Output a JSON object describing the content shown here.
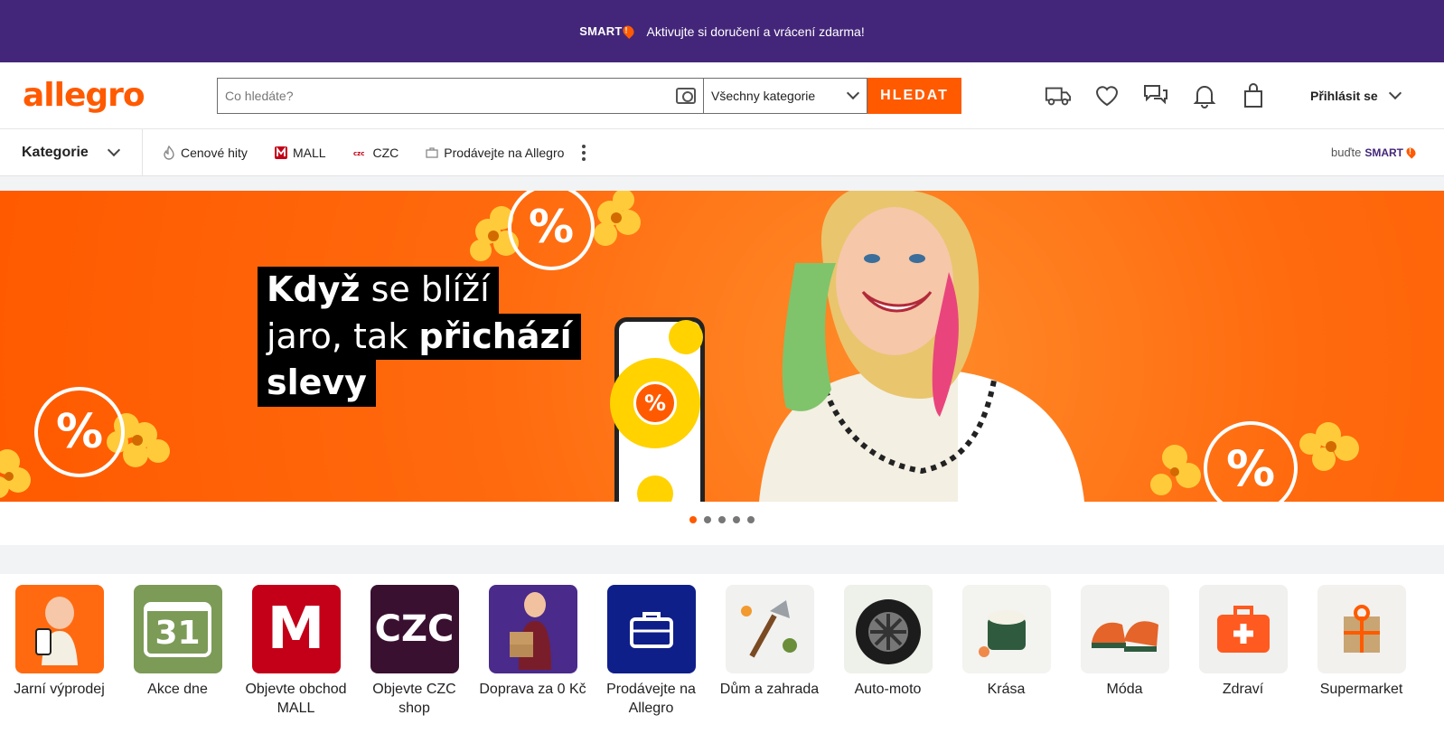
{
  "promo": {
    "brand": "SMART",
    "text": "Aktivujte si doručení a vrácení zdarma!"
  },
  "header": {
    "logo": "allegro",
    "search_placeholder": "Co hledáte?",
    "category_select": "Všechny kategorie",
    "search_button": "HLEDAT",
    "login": "Přihlásit se"
  },
  "nav": {
    "categories": "Kategorie",
    "links": [
      "Cenové hity",
      "MALL",
      "CZC",
      "Prodávejte na Allegro"
    ],
    "become_smart_prefix": "buďte",
    "become_smart_brand": "SMART"
  },
  "banner": {
    "line1_bold": "Když",
    "line1_rest": " se blíží",
    "line2_rest": "jaro, tak ",
    "line2_bold": "přichází",
    "line3_bold": "slevy",
    "pct_symbol": "%",
    "slides": 5,
    "active_slide": 1
  },
  "categories": [
    {
      "label": "Jarní výprodej",
      "color": "#ff6a10"
    },
    {
      "label": "Akce dne",
      "color": "#7c9b57",
      "glyph": "31"
    },
    {
      "label": "Objevte obchod MALL",
      "color": "#c40018",
      "glyph": "M"
    },
    {
      "label": "Objevte CZC shop",
      "color": "#3a1030",
      "glyph": "CZC"
    },
    {
      "label": "Doprava za 0 Kč",
      "color": "#4a2a8a"
    },
    {
      "label": "Prodávejte na Allegro",
      "color": "#0f1f8a"
    },
    {
      "label": "Dům a zahrada",
      "color": "#f1f1ef"
    },
    {
      "label": "Auto-moto",
      "color": "#eef0ea"
    },
    {
      "label": "Krása",
      "color": "#f3f3f0"
    },
    {
      "label": "Móda",
      "color": "#f2f2f0"
    },
    {
      "label": "Zdraví",
      "color": "#f0f0ee"
    },
    {
      "label": "Supermarket",
      "color": "#f3f1ee"
    }
  ]
}
